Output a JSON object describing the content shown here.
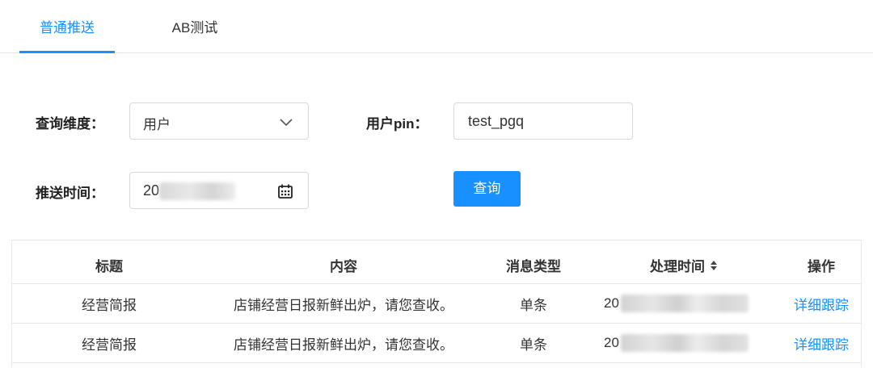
{
  "tabs": [
    {
      "label": "普通推送",
      "active": true
    },
    {
      "label": "AB测试",
      "active": false
    }
  ],
  "form": {
    "dimension_label": "查询维度：",
    "dimension_value": "用户",
    "pin_label": "用户pin：",
    "pin_value": "test_pgq",
    "time_label": "推送时间：",
    "time_value_prefix": "20",
    "query_button": "查询"
  },
  "table": {
    "headers": [
      "标题",
      "内容",
      "消息类型",
      "处理时间",
      "操作"
    ],
    "rows": [
      {
        "title": "经营简报",
        "content": "店铺经营日报新鲜出炉，请您查收。",
        "type": "单条",
        "time_prefix": "20",
        "action": "详细跟踪"
      },
      {
        "title": "经营简报",
        "content": "店铺经营日报新鲜出炉，请您查收。",
        "type": "单条",
        "time_prefix": "20",
        "action": "详细跟踪"
      }
    ]
  },
  "colors": {
    "accent": "#1890ff",
    "border": "#e8e8e8"
  },
  "icons": {
    "select_arrow": "chevron-down-icon",
    "date_picker": "calendar-icon",
    "sort": "sort-icon"
  }
}
